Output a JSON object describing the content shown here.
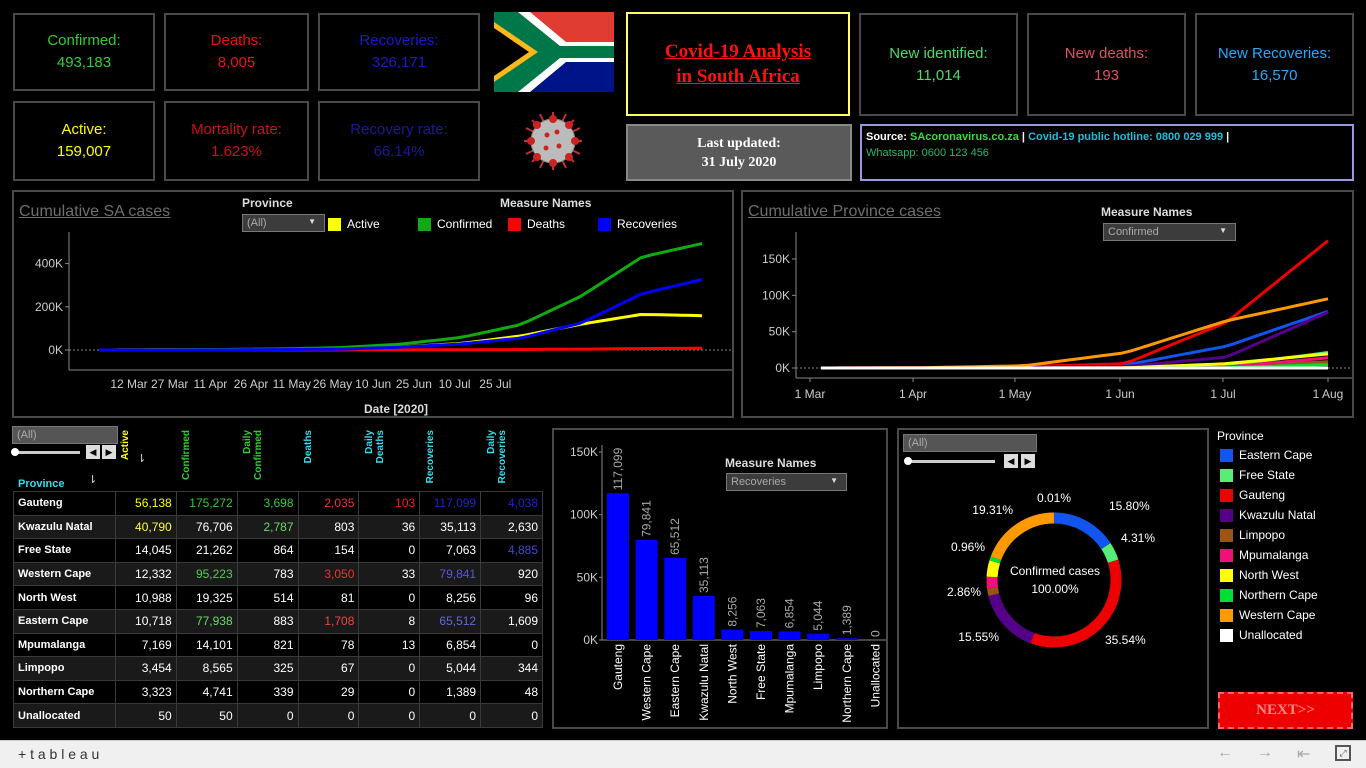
{
  "kpis": {
    "confirmed": {
      "label": "Confirmed:",
      "value": "493,183",
      "color": "#33cc33",
      "lc": "#33cc33"
    },
    "deaths": {
      "label": "Deaths:",
      "value": "8,005",
      "color": "#ee1111"
    },
    "recoveries": {
      "label": "Recoveries:",
      "value": "326,171",
      "color": "#1a1acc"
    },
    "active": {
      "label": "Active:",
      "value": "159,007",
      "color": "#ffff00"
    },
    "mortality": {
      "label": "Mortality rate:",
      "value": "1.623%",
      "color": "#cc1111"
    },
    "recovery_rate": {
      "label": "Recovery rate:",
      "value": "66.14%",
      "color": "#1a1a99"
    },
    "new_identified": {
      "label": "New identified:",
      "value": "11,014",
      "color": "#4cdb66"
    },
    "new_deaths": {
      "label": "New deaths:",
      "value": "193",
      "color": "#e05060"
    },
    "new_recoveries": {
      "label": "New Recoveries:",
      "value": "16,570",
      "color": "#22aaff"
    }
  },
  "header": {
    "title_line1": "Covid-19 Analysis",
    "title_line2": "in South Africa",
    "updated_line1": "Last updated:",
    "updated_line2": "31 July 2020"
  },
  "source": {
    "source_label": "Source:",
    "source_site": "SAcoronavirus.co.za",
    "sep1": "|",
    "hotline": "Covid-19 public hotline: 0800 029 999",
    "sep2": "|",
    "whatsapp": "Whatsapp: 0600 123 456"
  },
  "cum_sa": {
    "title": "Cumulative SA cases",
    "province_label": "Province",
    "province_value": "(All)",
    "measure_label": "Measure Names",
    "legend": [
      "Active",
      "Confirmed",
      "Deaths",
      "Recoveries"
    ],
    "colors": [
      "#ffff00",
      "#11aa11",
      "#ff0000",
      "#0000ff"
    ],
    "yticks": [
      "400K",
      "200K",
      "0K"
    ],
    "xticks": [
      "12 Mar",
      "27 Mar",
      "11 Apr",
      "26 Apr",
      "11 May",
      "26 May",
      "10 Jun",
      "25 Jun",
      "10 Jul",
      "25 Jul"
    ],
    "xlabel": "Date [2020]"
  },
  "cum_prov": {
    "title": "Cumulative Province cases",
    "measure_label": "Measure Names",
    "measure_value": "Confirmed",
    "yticks": [
      "150K",
      "100K",
      "50K",
      "0K"
    ],
    "xticks": [
      "1 Mar",
      "1 Apr",
      "1 May",
      "1 Jun",
      "1 Jul",
      "1 Aug"
    ]
  },
  "table": {
    "filter_value": "(All)",
    "headers": [
      "Active",
      "Confirmed",
      "Daily Confirmed",
      "Deaths",
      "Daily Deaths",
      "Recoveries",
      "Daily Recoveries"
    ],
    "header_colors": [
      "#ffff00",
      "#33cc33",
      "#33cc33",
      "#33ddee",
      "#33ddee",
      "#33ddee",
      "#33ddee"
    ],
    "province_header": "Province",
    "rows": [
      {
        "name": "Gauteng",
        "vals": [
          "56,138",
          "175,272",
          "3,698",
          "2,035",
          "103",
          "117,099",
          "4,038"
        ],
        "colors": [
          "#ffff00",
          "#33cc33",
          "#33cc33",
          "#ee3333",
          "#ee2222",
          "#2222cc",
          "#2222cc"
        ]
      },
      {
        "name": "Kwazulu Natal",
        "vals": [
          "40,790",
          "76,706",
          "2,787",
          "803",
          "36",
          "35,113",
          "2,630"
        ],
        "colors": [
          "#ffff33",
          "#ffffff",
          "#66dd66",
          "#ffffff",
          "#ffffff",
          "#ffffff",
          "#ffffff"
        ]
      },
      {
        "name": "Free State",
        "vals": [
          "14,045",
          "21,262",
          "864",
          "154",
          "0",
          "7,063",
          "4,885"
        ],
        "colors": [
          "#ffffff",
          "#ffffff",
          "#ffffff",
          "#ffffff",
          "#ffffff",
          "#ffffff",
          "#4444dd"
        ]
      },
      {
        "name": "Western Cape",
        "vals": [
          "12,332",
          "95,223",
          "783",
          "3,050",
          "33",
          "79,841",
          "920"
        ],
        "colors": [
          "#ffffff",
          "#55cc55",
          "#ffffff",
          "#ee3333",
          "#ffffff",
          "#5555dd",
          "#ffffff"
        ]
      },
      {
        "name": "North West",
        "vals": [
          "10,988",
          "19,325",
          "514",
          "81",
          "0",
          "8,256",
          "96"
        ],
        "colors": [
          "#ffffff",
          "#ffffff",
          "#ffffff",
          "#ffffff",
          "#ffffff",
          "#ffffff",
          "#ffffff"
        ]
      },
      {
        "name": "Eastern Cape",
        "vals": [
          "10,718",
          "77,938",
          "883",
          "1,708",
          "8",
          "65,512",
          "1,609"
        ],
        "colors": [
          "#ffffff",
          "#66dd66",
          "#ffffff",
          "#ee4444",
          "#ffffff",
          "#6666dd",
          "#ffffff"
        ]
      },
      {
        "name": "Mpumalanga",
        "vals": [
          "7,169",
          "14,101",
          "821",
          "78",
          "13",
          "6,854",
          "0"
        ],
        "colors": [
          "#ffffff",
          "#ffffff",
          "#ffffff",
          "#ffffff",
          "#ffffff",
          "#ffffff",
          "#ffffff"
        ]
      },
      {
        "name": "Limpopo",
        "vals": [
          "3,454",
          "8,565",
          "325",
          "67",
          "0",
          "5,044",
          "344"
        ],
        "colors": [
          "#ffffff",
          "#ffffff",
          "#ffffff",
          "#ffffff",
          "#ffffff",
          "#ffffff",
          "#ffffff"
        ]
      },
      {
        "name": "Northern Cape",
        "vals": [
          "3,323",
          "4,741",
          "339",
          "29",
          "0",
          "1,389",
          "48"
        ],
        "colors": [
          "#ffffff",
          "#ffffff",
          "#ffffff",
          "#ffffff",
          "#ffffff",
          "#ffffff",
          "#ffffff"
        ]
      },
      {
        "name": "Unallocated",
        "vals": [
          "50",
          "50",
          "0",
          "0",
          "0",
          "0",
          "0"
        ],
        "colors": [
          "#ffffff",
          "#ffffff",
          "#ffffff",
          "#ffffff",
          "#ffffff",
          "#ffffff",
          "#ffffff"
        ]
      }
    ]
  },
  "bar": {
    "measure_label": "Measure Names",
    "measure_value": "Recoveries",
    "yticks": [
      "150K",
      "100K",
      "50K",
      "0K"
    ]
  },
  "donut": {
    "filter_value": "(All)",
    "center_line1": "Confirmed cases",
    "center_line2": "100.00%",
    "labels": [
      "15.80%",
      "4.31%",
      "35.54%",
      "15.55%",
      "2.86%",
      "0.96%",
      "19.31%",
      "0.01%"
    ]
  },
  "province_legend": {
    "title": "Province",
    "items": [
      {
        "name": "Eastern Cape",
        "color": "#1155ee"
      },
      {
        "name": "Free State",
        "color": "#55ee77"
      },
      {
        "name": "Gauteng",
        "color": "#ee0000"
      },
      {
        "name": "Kwazulu Natal",
        "color": "#550088"
      },
      {
        "name": "Limpopo",
        "color": "#995511"
      },
      {
        "name": "Mpumalanga",
        "color": "#ee1177"
      },
      {
        "name": "North West",
        "color": "#ffff00"
      },
      {
        "name": "Northern Cape",
        "color": "#00dd33"
      },
      {
        "name": "Western Cape",
        "color": "#ff9900"
      },
      {
        "name": "Unallocated",
        "color": "#ffffff"
      }
    ]
  },
  "next_label": "NEXT>>",
  "footer": {
    "brand": "+ t a b l e a u"
  },
  "chart_data": [
    {
      "type": "line",
      "title": "Cumulative SA cases",
      "xlabel": "Date [2020]",
      "ylabel": "",
      "x": [
        "12 Mar",
        "27 Mar",
        "11 Apr",
        "26 Apr",
        "11 May",
        "26 May",
        "10 Jun",
        "25 Jun",
        "10 Jul",
        "25 Jul",
        "31 Jul"
      ],
      "ylim": [
        0,
        500000
      ],
      "series": [
        {
          "name": "Active",
          "values": [
            20,
            1000,
            1800,
            3000,
            7000,
            14000,
            30000,
            65000,
            120000,
            165000,
            159007
          ]
        },
        {
          "name": "Confirmed",
          "values": [
            20,
            1200,
            2200,
            4800,
            11000,
            27000,
            58000,
            118000,
            250000,
            430000,
            493183
          ]
        },
        {
          "name": "Deaths",
          "values": [
            0,
            0,
            30,
            90,
            200,
            550,
            1250,
            2300,
            4000,
            6600,
            8005
          ]
        },
        {
          "name": "Recoveries",
          "values": [
            0,
            30,
            400,
            1800,
            4000,
            13000,
            28000,
            55000,
            125000,
            260000,
            326171
          ]
        }
      ]
    },
    {
      "type": "line",
      "title": "Cumulative Province cases",
      "x": [
        "1 Mar",
        "1 Apr",
        "1 May",
        "1 Jun",
        "1 Jul",
        "1 Aug"
      ],
      "ylim": [
        0,
        180000
      ],
      "series": [
        {
          "name": "Eastern Cape",
          "values": [
            0,
            50,
            800,
            4000,
            30000,
            77938
          ]
        },
        {
          "name": "Free State",
          "values": [
            0,
            80,
            150,
            300,
            3500,
            21262
          ]
        },
        {
          "name": "Gauteng",
          "values": [
            0,
            600,
            1800,
            6000,
            63000,
            175272
          ]
        },
        {
          "name": "Kwazulu Natal",
          "values": [
            0,
            200,
            1000,
            2000,
            15000,
            76706
          ]
        },
        {
          "name": "Limpopo",
          "values": [
            0,
            20,
            40,
            150,
            1500,
            8565
          ]
        },
        {
          "name": "Mpumalanga",
          "values": [
            0,
            10,
            50,
            150,
            1200,
            14101
          ]
        },
        {
          "name": "North West",
          "values": [
            0,
            20,
            50,
            150,
            6000,
            19325
          ]
        },
        {
          "name": "Northern Cape",
          "values": [
            0,
            10,
            20,
            40,
            400,
            4741
          ]
        },
        {
          "name": "Western Cape",
          "values": [
            0,
            400,
            3000,
            21000,
            65000,
            95223
          ]
        },
        {
          "name": "Unallocated",
          "values": [
            0,
            0,
            0,
            50,
            50,
            50
          ]
        }
      ]
    },
    {
      "type": "bar",
      "title": "",
      "categories": [
        "Gauteng",
        "Western Cape",
        "Eastern Cape",
        "Kwazulu Natal",
        "North West",
        "Free State",
        "Mpumalanga",
        "Limpopo",
        "Northern Cape",
        "Unallocated"
      ],
      "values": [
        117099,
        79841,
        65512,
        35113,
        8256,
        7063,
        6854,
        5044,
        1389,
        0
      ],
      "value_labels": [
        "117,099",
        "79,841",
        "65,512",
        "35,113",
        "8,256",
        "7,063",
        "6,854",
        "5,044",
        "1,389",
        "0"
      ],
      "ylim": [
        0,
        150000
      ],
      "color": "#0000ff"
    },
    {
      "type": "pie",
      "title": "Confirmed cases",
      "categories": [
        "Eastern Cape",
        "Free State",
        "Gauteng",
        "Kwazulu Natal",
        "Limpopo",
        "Mpumalanga",
        "North West",
        "Northern Cape",
        "Western Cape",
        "Unallocated"
      ],
      "values": [
        15.8,
        4.31,
        35.54,
        15.55,
        1.74,
        2.86,
        3.92,
        0.96,
        19.31,
        0.01
      ]
    }
  ]
}
